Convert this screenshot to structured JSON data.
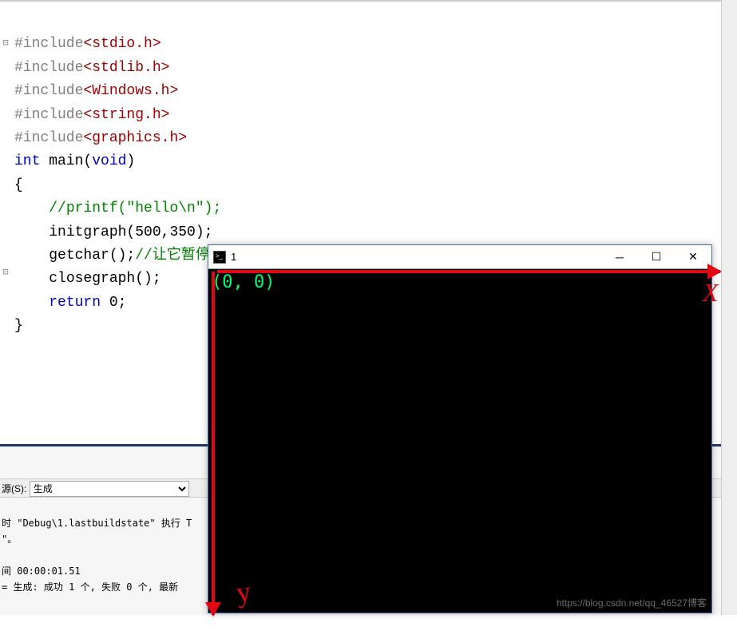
{
  "code": {
    "l1_inc": "#include",
    "l1_hdr": "<stdio.h>",
    "l2_inc": "#include",
    "l2_hdr": "<stdlib.h>",
    "l3_inc": "#include",
    "l3_hdr": "<Windows.h>",
    "l4_inc": "#include",
    "l4_hdr": "<string.h>",
    "l5_inc": "#include",
    "l5_hdr": "<graphics.h>",
    "l6_kw1": "int",
    "l6_fn": " main(",
    "l6_kw2": "void",
    "l6_end": ")",
    "l7": "{",
    "l8_cm": "//printf(\"hello\\n\");",
    "l9": "initgraph(500,350);",
    "l10a": "getchar();",
    "l10_cm": "//让它暂停一下不然窗口一闪而过",
    "l11": "closegraph();",
    "l12_kw": "return",
    "l12_rest": " 0;",
    "l13": "}"
  },
  "output": {
    "source_label": "源(S):",
    "source_value": "生成",
    "line1": "时 \"Debug\\1.lastbuildstate\" 执行 T",
    "line2": "\"。",
    "line3": "",
    "line4": "间 00:00:01.51",
    "line5": "= 生成: 成功 1 个, 失败 0 个, 最新"
  },
  "console": {
    "title": "1",
    "coord": "(0, 0)"
  },
  "annotations": {
    "x_label": "X",
    "y_label": "y"
  },
  "watermark": "https://blog.csdn.net/qq_46527博客"
}
